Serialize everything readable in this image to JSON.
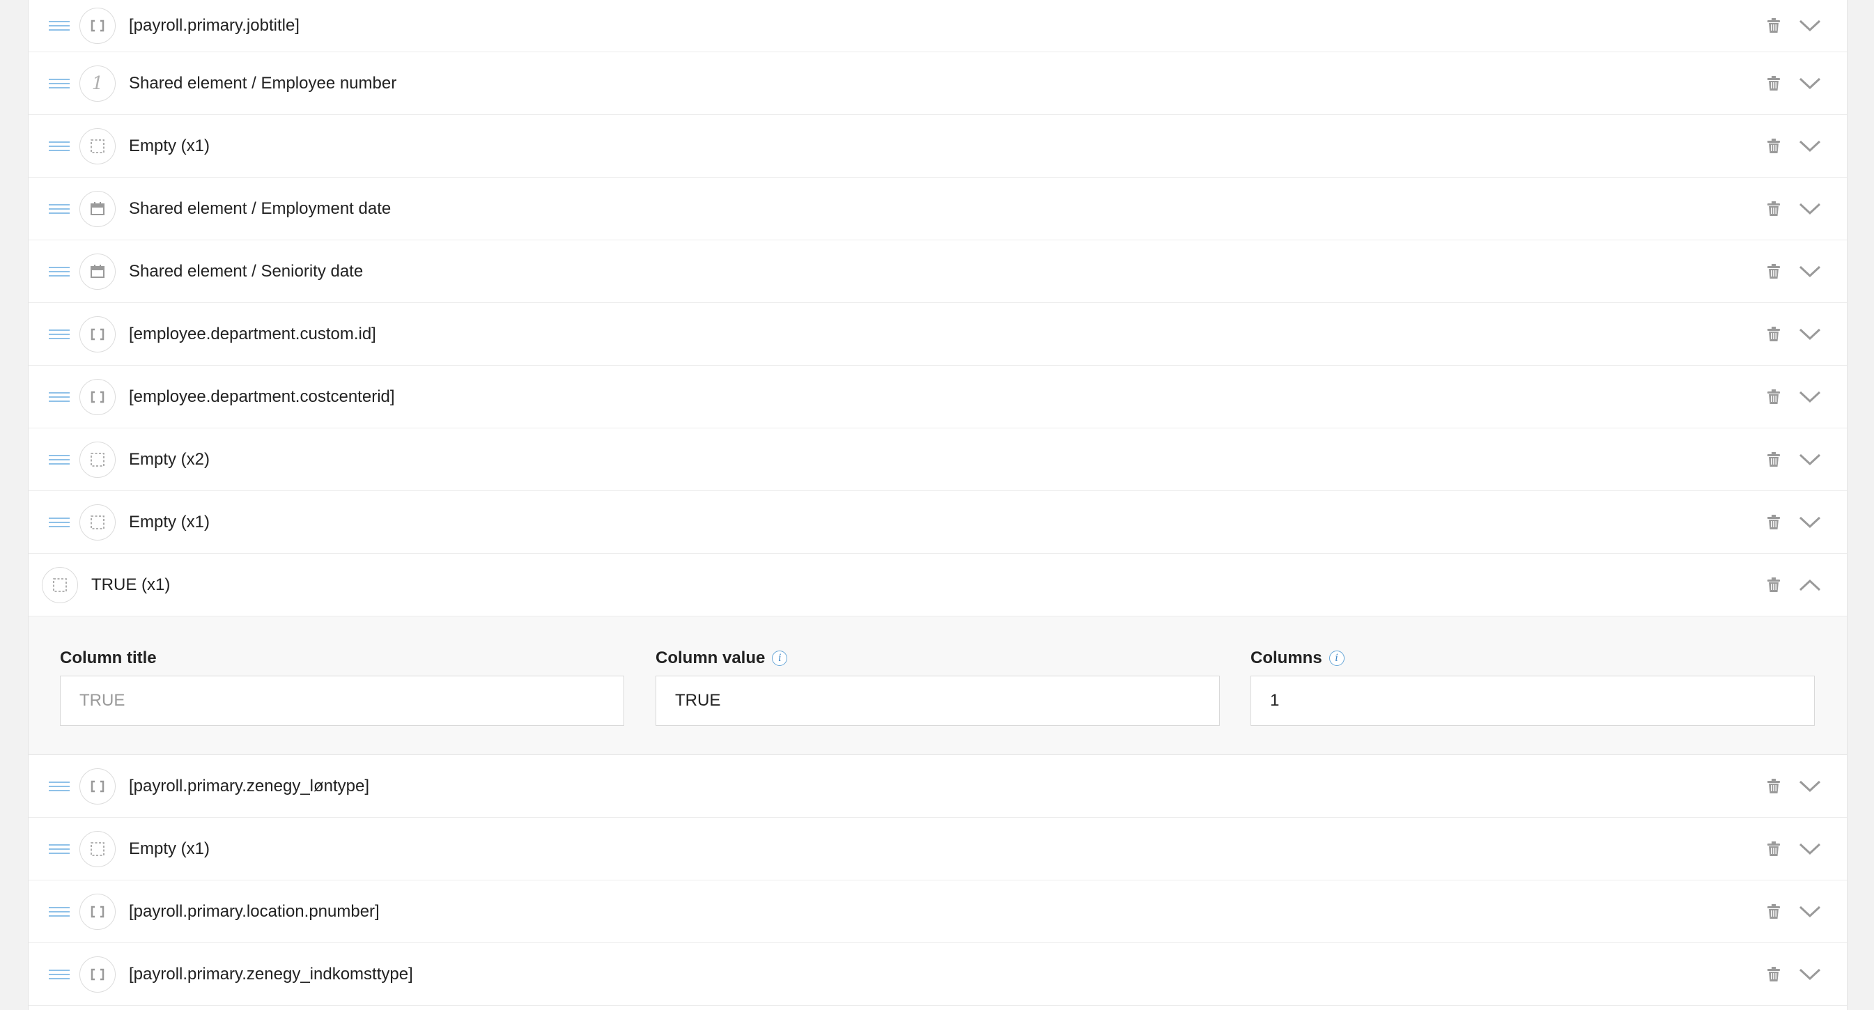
{
  "rows_before": [
    {
      "label": "[payroll.primary.jobtitle]",
      "icon": "brackets-icon"
    },
    {
      "label": "Shared element / Employee number",
      "icon": "number-icon"
    },
    {
      "label": "Empty (x1)",
      "icon": "dashed-square-icon"
    },
    {
      "label": "Shared element / Employment date",
      "icon": "calendar-icon"
    },
    {
      "label": "Shared element / Seniority date",
      "icon": "calendar-icon"
    },
    {
      "label": "[employee.department.custom.id]",
      "icon": "brackets-icon"
    },
    {
      "label": "[employee.department.costcenterid]",
      "icon": "brackets-icon"
    },
    {
      "label": "Empty (x2)",
      "icon": "dashed-square-icon"
    },
    {
      "label": "Empty (x1)",
      "icon": "dashed-square-icon"
    }
  ],
  "expanded": {
    "label": "TRUE (x1)",
    "icon": "dashed-square-icon",
    "fields": {
      "column_title": {
        "label": "Column title",
        "value": "",
        "placeholder": "TRUE"
      },
      "column_value": {
        "label": "Column value",
        "value": "TRUE",
        "placeholder": ""
      },
      "columns": {
        "label": "Columns",
        "value": "1",
        "placeholder": ""
      }
    },
    "info_glyph": "i"
  },
  "rows_after": [
    {
      "label": "[payroll.primary.zenegy_løntype]",
      "icon": "brackets-icon"
    },
    {
      "label": "Empty (x1)",
      "icon": "dashed-square-icon"
    },
    {
      "label": "[payroll.primary.location.pnumber]",
      "icon": "brackets-icon"
    },
    {
      "label": "[payroll.primary.zenegy_indkomsttype]",
      "icon": "brackets-icon"
    }
  ],
  "colors": {
    "drag_handle": "#8fc1e8",
    "icon_gray": "#9a9a9a",
    "info_blue": "#3d86c6"
  }
}
